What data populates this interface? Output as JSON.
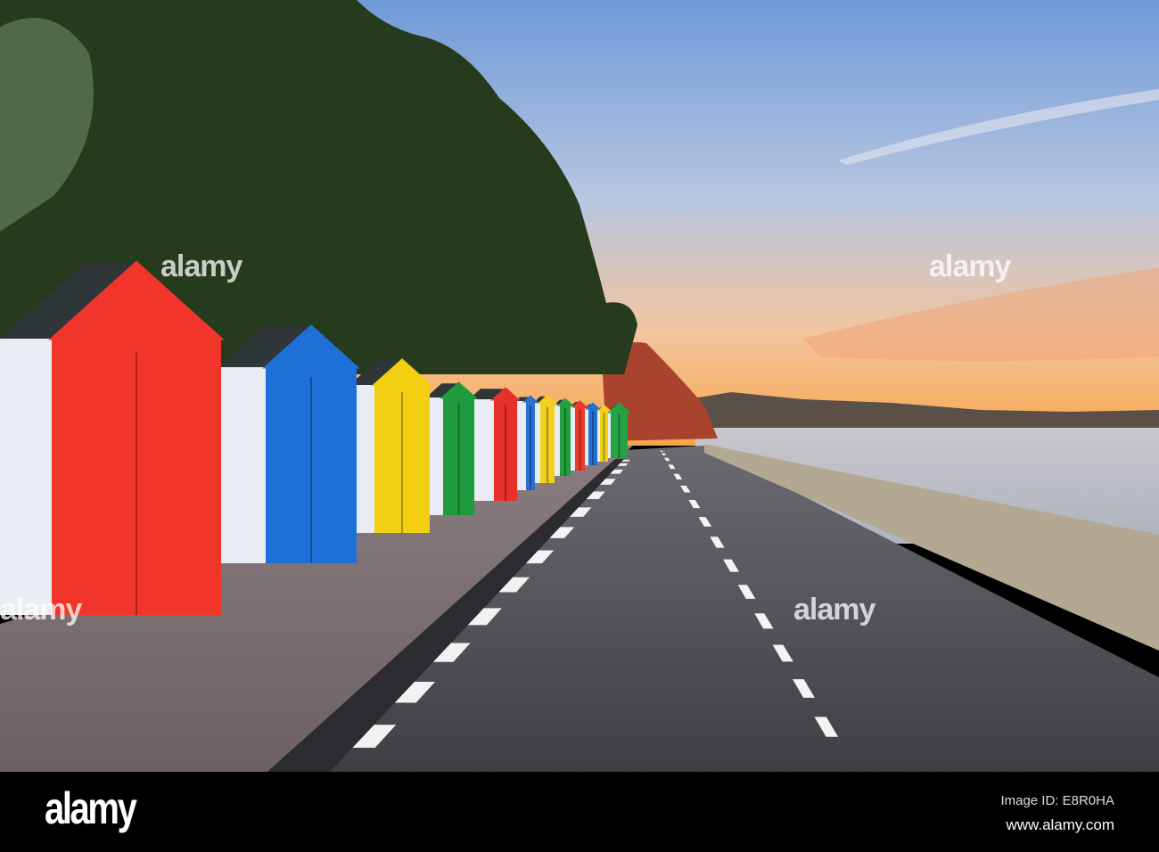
{
  "photo": {
    "subject": "Beach huts along a seaside promenade at sunset",
    "hut_colors": [
      "#f2352a",
      "#1f6fd8",
      "#f3cf12",
      "#1e9b3c",
      "#e8302a",
      "#2a6fd6",
      "#f0d020",
      "#22a040",
      "#ee3a2c",
      "#2470d0",
      "#f2d21c",
      "#24a244"
    ],
    "sky_colors": [
      "#7fa6de",
      "#b9c7e2",
      "#f5c39a",
      "#f8a040"
    ],
    "watermark": "alamy"
  },
  "footer": {
    "logo": "alamy",
    "image_id": "Image ID: E8R0HA",
    "website": "www.alamy.com"
  }
}
